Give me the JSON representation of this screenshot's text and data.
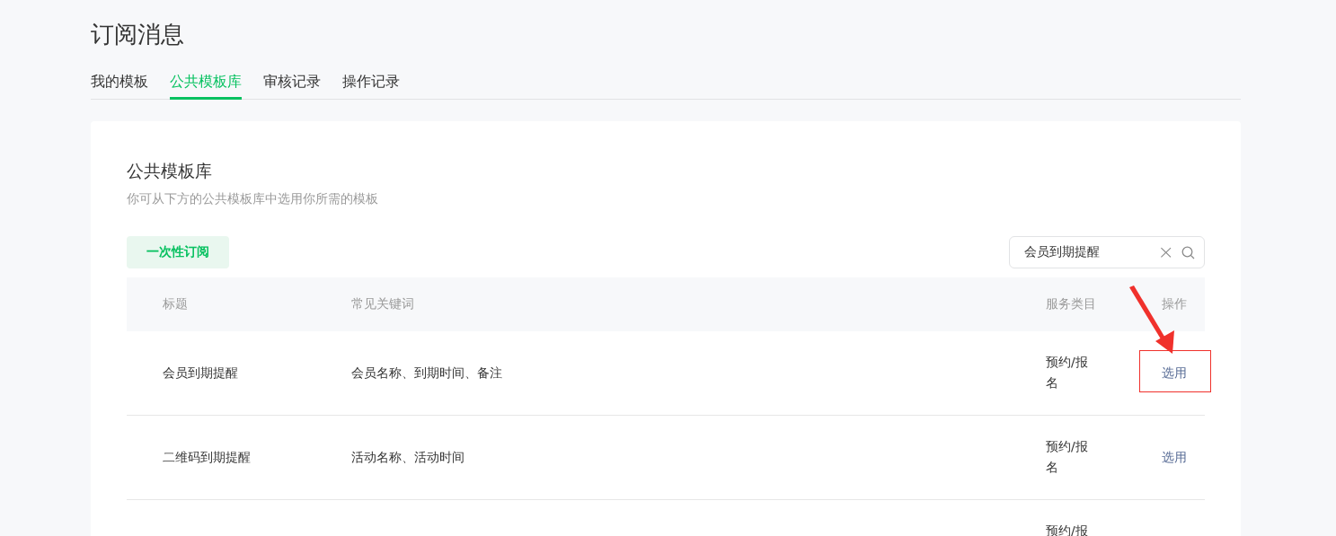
{
  "page_title": "订阅消息",
  "tabs": [
    {
      "label": "我的模板",
      "selected": false
    },
    {
      "label": "公共模板库",
      "selected": true
    },
    {
      "label": "审核记录",
      "selected": false
    },
    {
      "label": "操作记录",
      "selected": false
    }
  ],
  "panel": {
    "title": "公共模板库",
    "description": "你可从下方的公共模板库中选用你所需的模板"
  },
  "filter_button": "一次性订阅",
  "search": {
    "value": "会员到期提醒",
    "clear_icon": "×"
  },
  "table": {
    "columns": [
      "标题",
      "常见关键词",
      "服务类目",
      "操作"
    ],
    "rows": [
      {
        "title": "会员到期提醒",
        "keywords": "会员名称、到期时间、备注",
        "category": "预约/报名",
        "action": "选用",
        "highlighted": true
      },
      {
        "title": "二维码到期提醒",
        "keywords": "活动名称、活动时间",
        "category": "预约/报名",
        "action": "选用",
        "highlighted": false
      },
      {
        "category": "预约/报",
        "highlighted": false
      }
    ]
  }
}
